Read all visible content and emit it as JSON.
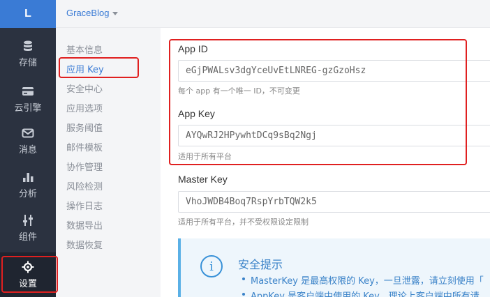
{
  "logo": {
    "letter": "L"
  },
  "app": {
    "name": "GraceBlog"
  },
  "nav": {
    "items": [
      {
        "label": "存储",
        "icon": "database-icon"
      },
      {
        "label": "云引擎",
        "icon": "credit-card-icon"
      },
      {
        "label": "消息",
        "icon": "envelope-icon"
      },
      {
        "label": "分析",
        "icon": "bar-chart-icon"
      },
      {
        "label": "组件",
        "icon": "sliders-icon"
      },
      {
        "label": "设置",
        "icon": "gear-icon"
      }
    ]
  },
  "submenu": {
    "items": [
      {
        "label": "基本信息"
      },
      {
        "label": "应用 Key"
      },
      {
        "label": "安全中心"
      },
      {
        "label": "应用选项"
      },
      {
        "label": "服务阈值"
      },
      {
        "label": "邮件模板"
      },
      {
        "label": "协作管理"
      },
      {
        "label": "风险检测"
      },
      {
        "label": "操作日志"
      },
      {
        "label": "数据导出"
      },
      {
        "label": "数据恢复"
      }
    ]
  },
  "fields": {
    "app_id": {
      "label": "App ID",
      "value": "eGjPWALsv3dgYceUvEtLNREG-gzGzoHsz",
      "hint": "每个 app 有一个唯一 ID，不可变更"
    },
    "app_key": {
      "label": "App Key",
      "value": "AYQwRJ2HPywhtDCq9sBq2Ngj",
      "hint": "适用于所有平台"
    },
    "master_key": {
      "label": "Master Key",
      "value": "VhoJWDB4Boq7RspYrbTQW2k5",
      "hint": "适用于所有平台，并不受权限设定限制"
    }
  },
  "tip": {
    "title": "安全提示",
    "lines": [
      "MasterKey 是最高权限的 Key，一旦泄露，请立刻使用「",
      "AppKey 是客户端中使用的 Key，理论上客户端中所有请"
    ]
  },
  "colors": {
    "accent": "#3a7bd5",
    "nav_bg": "#2b3240",
    "annotation": "#e02020"
  }
}
